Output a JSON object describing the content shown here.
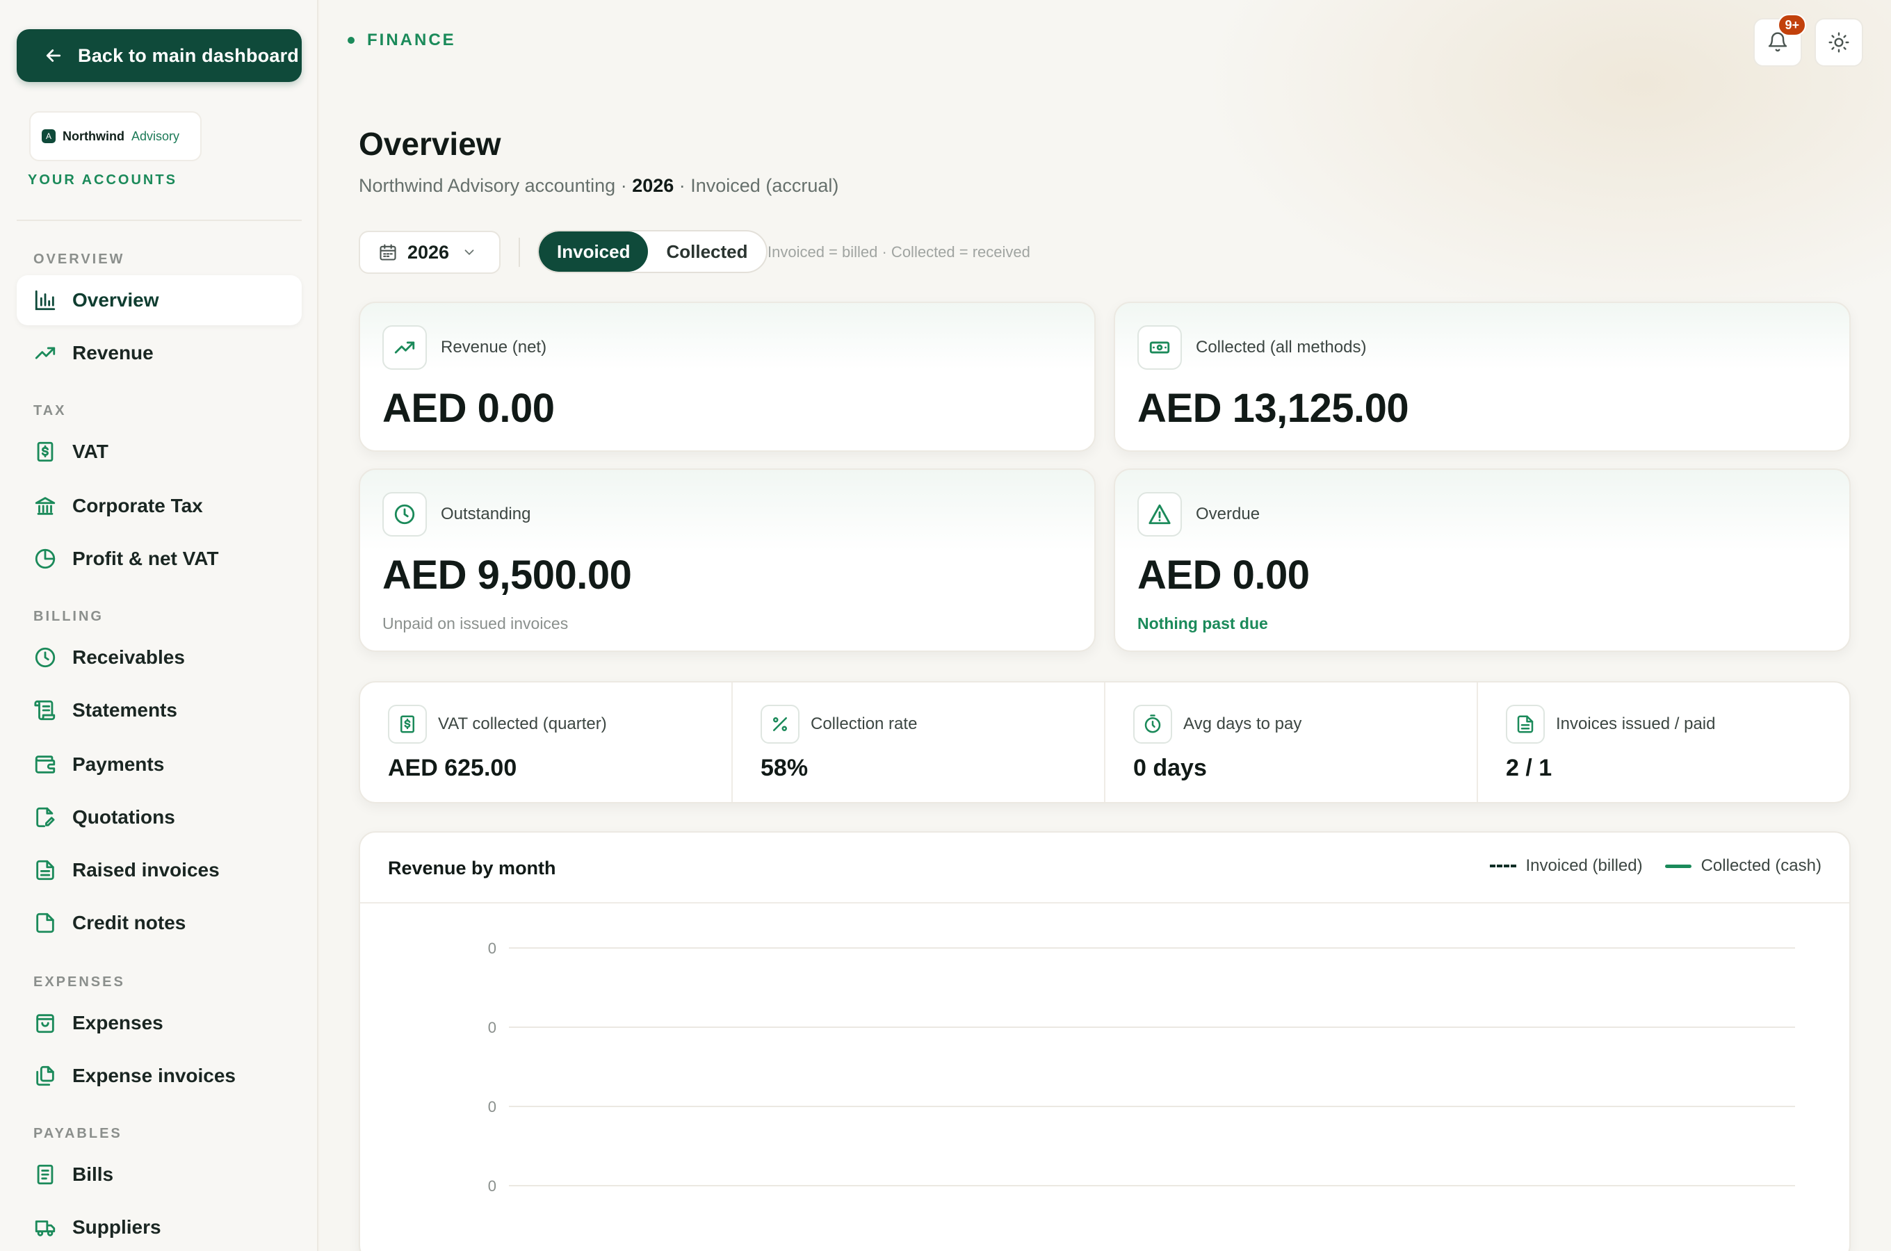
{
  "sidebar": {
    "back_label": "Back to main dashboard",
    "brand_name": "Northwind",
    "brand_sub": "Advisory",
    "brand_logo": "A",
    "accounts_label": "YOUR ACCOUNTS",
    "sections": [
      {
        "label": "OVERVIEW",
        "items": [
          {
            "label": "Overview",
            "icon": "bar-chart-icon",
            "active": true
          },
          {
            "label": "Revenue",
            "icon": "trend-up-icon"
          }
        ]
      },
      {
        "label": "TAX",
        "items": [
          {
            "label": "VAT",
            "icon": "receipt-dollar-icon"
          },
          {
            "label": "Corporate Tax",
            "icon": "bank-icon"
          },
          {
            "label": "Profit & net VAT",
            "icon": "pie-chart-icon"
          }
        ]
      },
      {
        "label": "BILLING",
        "items": [
          {
            "label": "Receivables",
            "icon": "clock-icon"
          },
          {
            "label": "Statements",
            "icon": "scroll-icon"
          },
          {
            "label": "Payments",
            "icon": "wallet-icon"
          },
          {
            "label": "Quotations",
            "icon": "file-edit-icon"
          },
          {
            "label": "Raised invoices",
            "icon": "file-text-icon"
          },
          {
            "label": "Credit notes",
            "icon": "file-icon"
          }
        ]
      },
      {
        "label": "EXPENSES",
        "items": [
          {
            "label": "Expenses",
            "icon": "bag-icon"
          },
          {
            "label": "Expense invoices",
            "icon": "files-icon"
          }
        ]
      },
      {
        "label": "PAYABLES",
        "items": [
          {
            "label": "Bills",
            "icon": "receipt-icon"
          },
          {
            "label": "Suppliers",
            "icon": "truck-icon"
          }
        ]
      }
    ]
  },
  "header": {
    "crumb": "FINANCE",
    "notif_badge": "9+",
    "title": "Overview",
    "sub_prefix": "Northwind Advisory accounting · ",
    "sub_year": "2026",
    "sub_suffix": " · Invoiced (accrual)"
  },
  "filters": {
    "year": "2026",
    "mode_invoiced": "Invoiced",
    "mode_collected": "Collected",
    "note": "Invoiced = billed · Collected = received"
  },
  "cards": [
    {
      "label": "Revenue (net)",
      "value": "AED 0.00",
      "note": "",
      "icon": "trend-up-icon"
    },
    {
      "label": "Collected (all methods)",
      "value": "AED 13,125.00",
      "note": "",
      "icon": "banknote-icon"
    },
    {
      "label": "Outstanding",
      "value": "AED 9,500.00",
      "note": "Unpaid on issued invoices",
      "icon": "clock-icon"
    },
    {
      "label": "Overdue",
      "value": "AED 0.00",
      "note": "Nothing past due",
      "icon": "warning-icon"
    }
  ],
  "stats": [
    {
      "label": "VAT collected (quarter)",
      "value": "AED 625.00",
      "icon": "receipt-dollar-icon"
    },
    {
      "label": "Collection rate",
      "value": "58%",
      "icon": "percent-icon"
    },
    {
      "label": "Avg days to pay",
      "value": "0 days",
      "icon": "timer-icon"
    },
    {
      "label": "Invoices issued / paid",
      "value": "2 / 1",
      "icon": "file-text-icon"
    }
  ],
  "chart": {
    "title": "Revenue by month",
    "legend_invoiced": "Invoiced (billed)",
    "legend_collected": "Collected (cash)"
  },
  "chart_data": {
    "type": "line",
    "title": "Revenue by month",
    "xlabel": "",
    "ylabel": "",
    "y_tick_labels": [
      "0",
      "0",
      "0",
      "0"
    ],
    "series": [
      {
        "name": "Invoiced (billed)",
        "values": []
      },
      {
        "name": "Collected (cash)",
        "values": []
      }
    ],
    "grid": true,
    "legend": "top-right",
    "colors": {
      "invoiced": "#0f2e26",
      "collected": "#1b8a5a"
    }
  },
  "colors": {
    "accent": "#0f4a3a",
    "green": "#1b8a5a",
    "badge": "#c2410c"
  }
}
